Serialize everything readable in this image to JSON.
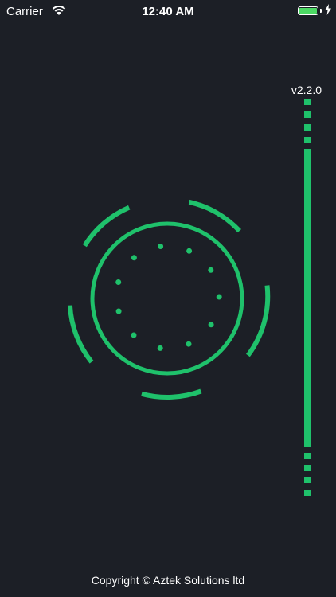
{
  "status_bar": {
    "carrier": "Carrier",
    "time": "12:40 AM",
    "wifi_icon": "wifi-icon",
    "battery_icon": "battery-icon",
    "charging_icon": "charging-bolt-icon"
  },
  "version": "v2.2.0",
  "footer": {
    "copyright": "Copyright © Aztek Solutions ltd"
  },
  "theme": {
    "background": "#1c1f26",
    "accent": "#1fc16b",
    "battery": "#4cd964"
  },
  "loader_icon": "circular-loading-spinner-icon"
}
